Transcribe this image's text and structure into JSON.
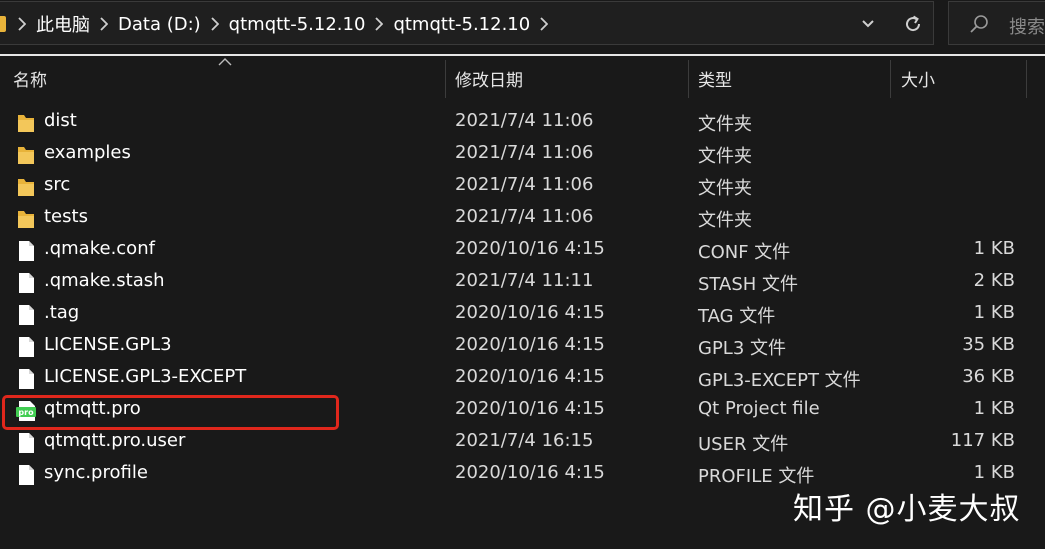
{
  "address_bar": {
    "breadcrumbs": [
      "此电脑",
      "Data (D:)",
      "qtmqtt-5.12.10",
      "qtmqtt-5.12.10"
    ],
    "search_placeholder": "搜索"
  },
  "columns": {
    "name": "名称",
    "date": "修改日期",
    "type": "类型",
    "size": "大小"
  },
  "files": [
    {
      "name": "dist",
      "date": "2021/7/4 11:06",
      "type": "文件夹",
      "size": "",
      "icon": "folder-icon"
    },
    {
      "name": "examples",
      "date": "2021/7/4 11:06",
      "type": "文件夹",
      "size": "",
      "icon": "folder-icon"
    },
    {
      "name": "src",
      "date": "2021/7/4 11:06",
      "type": "文件夹",
      "size": "",
      "icon": "folder-icon"
    },
    {
      "name": "tests",
      "date": "2021/7/4 11:06",
      "type": "文件夹",
      "size": "",
      "icon": "folder-icon"
    },
    {
      "name": ".qmake.conf",
      "date": "2020/10/16 4:15",
      "type": "CONF 文件",
      "size": "1 KB",
      "icon": "file-icon"
    },
    {
      "name": ".qmake.stash",
      "date": "2021/7/4 11:11",
      "type": "STASH 文件",
      "size": "2 KB",
      "icon": "file-icon"
    },
    {
      "name": ".tag",
      "date": "2020/10/16 4:15",
      "type": "TAG 文件",
      "size": "1 KB",
      "icon": "file-icon"
    },
    {
      "name": "LICENSE.GPL3",
      "date": "2020/10/16 4:15",
      "type": "GPL3 文件",
      "size": "35 KB",
      "icon": "file-icon"
    },
    {
      "name": "LICENSE.GPL3-EXCEPT",
      "date": "2020/10/16 4:15",
      "type": "GPL3-EXCEPT 文件",
      "size": "36 KB",
      "icon": "file-icon"
    },
    {
      "name": "qtmqtt.pro",
      "date": "2020/10/16 4:15",
      "type": "Qt Project file",
      "size": "1 KB",
      "icon": "qt-pro-file-icon",
      "icon_label": "pro"
    },
    {
      "name": "qtmqtt.pro.user",
      "date": "2021/7/4 16:15",
      "type": "USER 文件",
      "size": "117 KB",
      "icon": "file-icon"
    },
    {
      "name": "sync.profile",
      "date": "2020/10/16 4:15",
      "type": "PROFILE 文件",
      "size": "1 KB",
      "icon": "file-icon"
    }
  ],
  "watermark": "知乎 @小麦大叔",
  "colors": {
    "background": "#191919",
    "folder": "#e8b33a",
    "highlight": "#e0271c",
    "qt_green": "#41cd52"
  }
}
